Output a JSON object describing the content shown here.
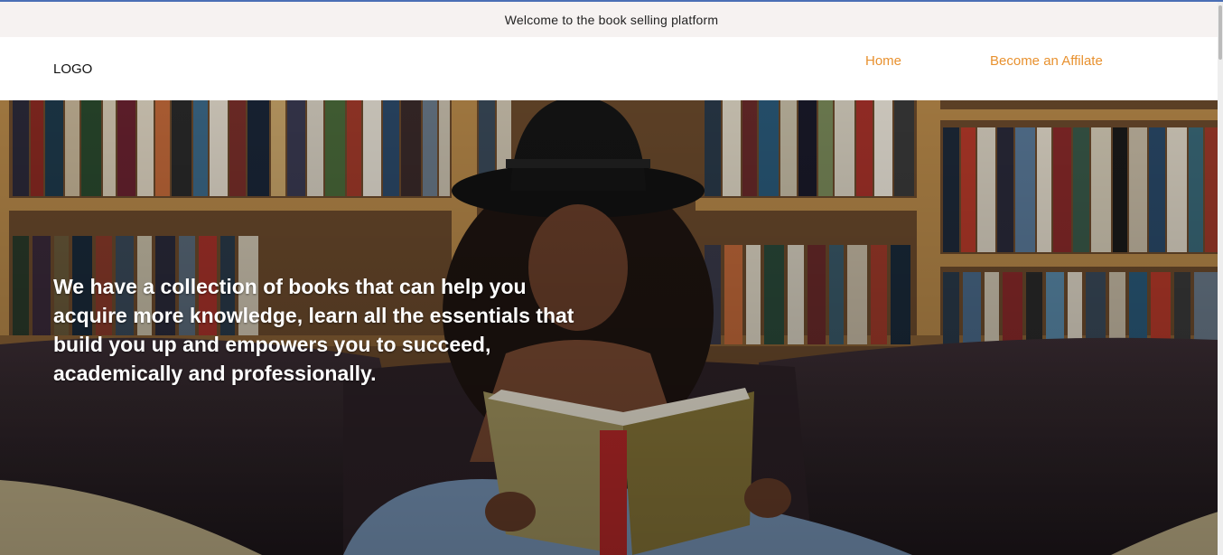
{
  "banner": {
    "text": "Welcome to the book selling platform"
  },
  "nav": {
    "logo": "LOGO",
    "links": [
      {
        "label": "Home"
      },
      {
        "label": "Become an Affilate"
      }
    ],
    "link_color": "#e8912f"
  },
  "hero": {
    "headline": "We have a collection of books that can help you acquire more knowledge, learn all the essentials that build you up and empowers you to succeed, academically and professionally.",
    "image": "woman-reading-book-on-leather-couch-in-front-of-bookshelves"
  }
}
